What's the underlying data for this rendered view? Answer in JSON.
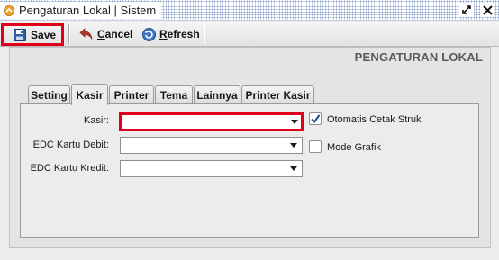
{
  "window": {
    "title": "Pengaturan Lokal | Sistem",
    "icon": "app-icon",
    "controls": [
      "restore-icon",
      "close-icon"
    ]
  },
  "toolbar": {
    "save_label": "ave",
    "save_mnemonic": "S",
    "cancel_label": "ancel",
    "cancel_mnemonic": "C",
    "refresh_label": "efresh",
    "refresh_mnemonic": "R"
  },
  "page": {
    "heading": "PENGATURAN LOKAL"
  },
  "tabs": [
    {
      "label": "Setting",
      "active": false
    },
    {
      "label": "Kasir",
      "active": true
    },
    {
      "label": "Printer",
      "active": false
    },
    {
      "label": "Tema",
      "active": false
    },
    {
      "label": "Lainnya",
      "active": false
    },
    {
      "label": "Printer Kasir",
      "active": false
    }
  ],
  "form": {
    "kasir": {
      "label": "Kasir:",
      "value": ""
    },
    "edc_debit": {
      "label": "EDC Kartu Debit:",
      "value": ""
    },
    "edc_kredit": {
      "label": "EDC Kartu Kredit:",
      "value": ""
    },
    "otomatis_cetak_struk": {
      "label": "Otomatis Cetak Struk",
      "checked": true
    },
    "mode_grafik": {
      "label": "Mode Grafik",
      "checked": false
    }
  },
  "colors": {
    "highlight": "#e0001b",
    "title_dots": "#8ea0cf",
    "heading": "#5a5a5a"
  }
}
